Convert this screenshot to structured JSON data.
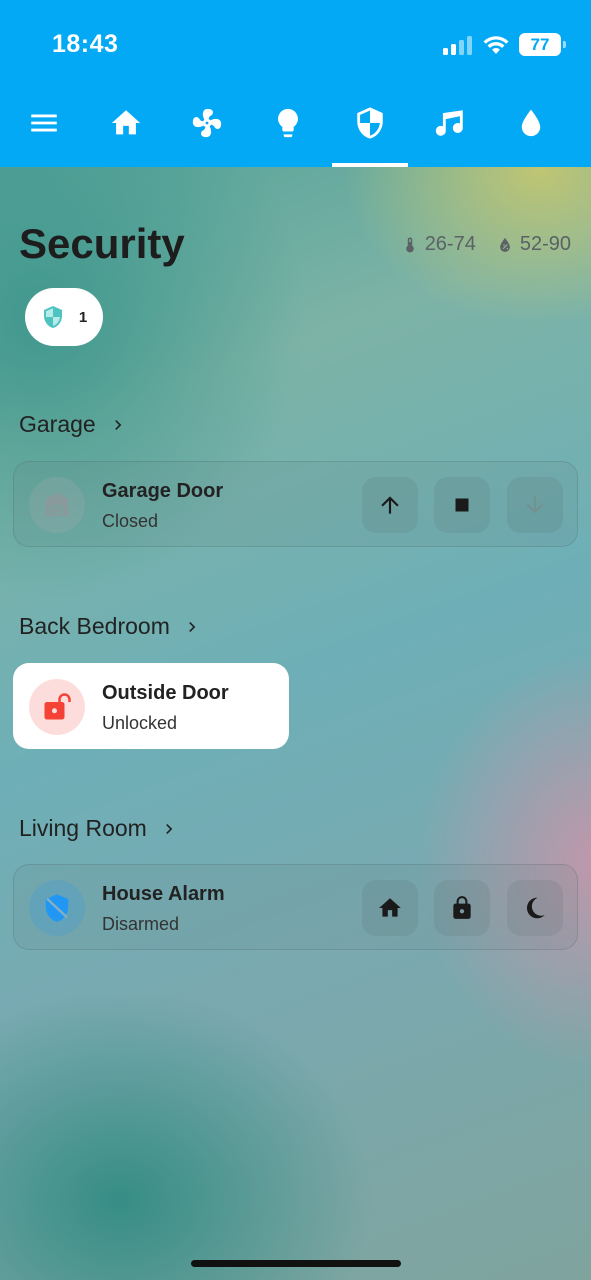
{
  "status_bar": {
    "time": "18:43",
    "battery": "77"
  },
  "colors": {
    "accent": "#03a9f4",
    "unlocked": "#f44336",
    "alarm_disarmed": "#2196f3"
  },
  "tabs": [
    {
      "icon": "menu-icon"
    },
    {
      "icon": "home-icon"
    },
    {
      "icon": "fan-icon"
    },
    {
      "icon": "lightbulb-icon"
    },
    {
      "icon": "shield-icon",
      "selected": true
    },
    {
      "icon": "music-note-icon"
    },
    {
      "icon": "water-drop-icon"
    }
  ],
  "page": {
    "title": "Security",
    "temperature_range": "26-74",
    "humidity_range": "52-90",
    "badge_count": "1"
  },
  "areas": [
    {
      "name": "Garage",
      "card": {
        "name": "Garage Door",
        "state": "Closed",
        "controls": [
          "arrow-up-icon",
          "stop-icon",
          "arrow-down-icon"
        ]
      }
    },
    {
      "name": "Back Bedroom",
      "card": {
        "name": "Outside Door",
        "state": "Unlocked"
      }
    },
    {
      "name": "Living Room",
      "card": {
        "name": "House Alarm",
        "state": "Disarmed",
        "controls": [
          "home-icon",
          "lock-icon",
          "moon-icon"
        ]
      }
    }
  ]
}
